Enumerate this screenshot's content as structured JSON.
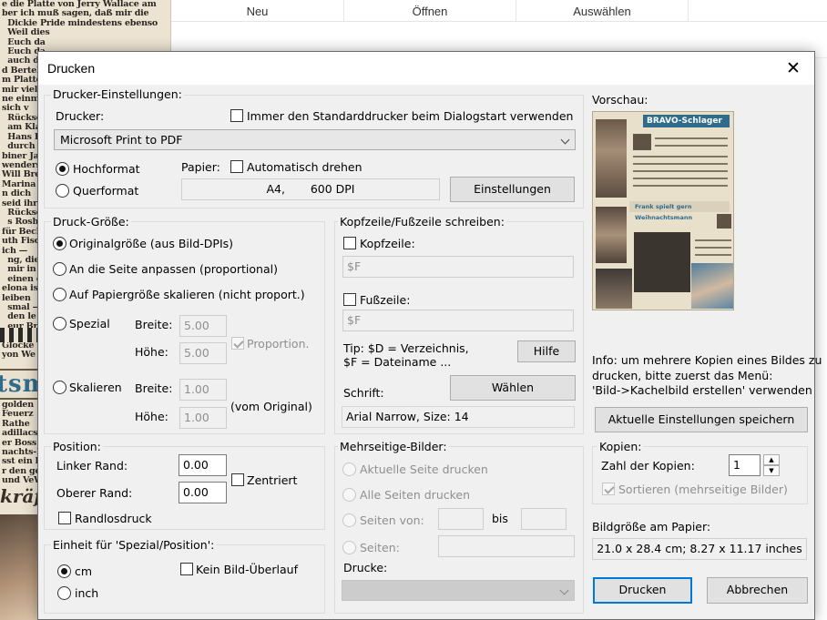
{
  "background": {
    "paper_text": "e die Platte von Jerry Wallace am\nber ich muß sagen, daß mir die\n  Dickie Pride mindestens ebenso\n  Weil dies\n  Euch da\n  Euch da\n  auch da\nd Bertelm\nm Platte W\nmir viel\nne einmal g\nsich v\n  Rückseit\n  am Klav\n  Hans Blum\n  durch\nbiner Jahre\nwenders ger\nWill Bren\nMarina — die\nn dich\nseid ihr\n  Rückseite\n  s Rosh\nfür Becher\nuth Fischer\nich —\n  ng, die al\n  mir in\n  einen d\nelona ist\nleiben\n  smal —\n  den le\n  eur Bra\nkönig\nGlocke\nyon We",
    "header_fragment": "tsm",
    "lower_text": "golden\nFeuerz\nRathe\nadillacs un\ner Boss\nnachts-Par\nsst ein hob\nr den ge\nund VeW",
    "italic_fragment": "kräft"
  },
  "app_header": {
    "columns": [
      "Neu",
      "Öffnen",
      "Auswählen"
    ]
  },
  "dialog": {
    "title": "Drucken",
    "close_glyph": "✕",
    "printer_settings": {
      "group_label": "Drucker-Einstellungen:",
      "printer_label": "Drucker:",
      "always_default_label": "Immer den Standarddrucker beim Dialogstart verwenden",
      "always_default_checked": false,
      "printer_value": "Microsoft Print to PDF",
      "portrait_label": "Hochformat",
      "landscape_label": "Querformat",
      "orientation_selected": "Hochformat",
      "paper_label": "Papier:",
      "auto_rotate_label": "Automatisch drehen",
      "auto_rotate_checked": false,
      "paper_format": "A4",
      "paper_dpi": "600 DPI",
      "settings_button": "Einstellungen"
    },
    "print_size": {
      "group_label": "Druck-Größe:",
      "options": [
        {
          "label": "Originalgröße (aus Bild-DPIs)",
          "selected": true
        },
        {
          "label": "An die Seite anpassen (proportional)",
          "selected": false
        },
        {
          "label": "Auf Papiergröße skalieren (nicht proport.)",
          "selected": false
        },
        {
          "label": "Spezial",
          "selected": false
        },
        {
          "label": "Skalieren",
          "selected": false
        }
      ],
      "width_label": "Breite:",
      "height_label": "Höhe:",
      "special_width": "5.00",
      "special_height": "5.00",
      "proportion_label": "Proportion.",
      "proportion_checked": true,
      "scale_width": "1.00",
      "scale_height": "1.00",
      "from_original_label": "(vom Original)"
    },
    "header_footer": {
      "group_label": "Kopfzeile/Fußzeile schreiben:",
      "header_label": "Kopfzeile:",
      "header_value": "$F",
      "footer_label": "Fußzeile:",
      "footer_value": "$F",
      "tip_line1": "Tip: $D = Verzeichnis,",
      "tip_line2": "$F = Dateiname ...",
      "help_button": "Hilfe",
      "font_label": "Schrift:",
      "choose_button": "Wählen",
      "font_value": "Arial Narrow, Size: 14"
    },
    "position": {
      "group_label": "Position:",
      "left_margin_label": "Linker Rand:",
      "left_margin_value": "0.00",
      "top_margin_label": "Oberer Rand:",
      "top_margin_value": "0.00",
      "centered_label": "Zentriert",
      "borderless_label": "Randlosdruck"
    },
    "unit": {
      "group_label": "Einheit für 'Spezial/Position':",
      "cm_label": "cm",
      "inch_label": "inch",
      "selected": "cm",
      "no_overflow_label": "Kein Bild-Überlauf"
    },
    "multipage": {
      "group_label": "Mehrseitige-Bilder:",
      "current_page_label": "Aktuelle Seite drucken",
      "all_pages_label": "Alle Seiten drucken",
      "pages_from_label": "Seiten von:",
      "to_label": "bis",
      "pages_label": "Seiten:",
      "prints_label": "Drucke:"
    },
    "preview": {
      "label": "Vorschau:",
      "banner_text": "BRAVO-Schlager",
      "subhead": "Frank spielt gern Weihnachtsmann",
      "info_text_line1": "Info: um mehrere Kopien eines Bildes zu",
      "info_text_line2": "drucken, bitte zuerst das Menü:",
      "info_text_line3": "'Bild->Kachelbild erstellen' verwenden",
      "save_settings_button": "Aktuelle Einstellungen speichern"
    },
    "copies": {
      "group_label": "Kopien:",
      "count_label": "Zahl der Kopien:",
      "count_value": "1",
      "sort_label": "Sortieren (mehrseitige Bilder)",
      "sort_checked": true
    },
    "image_size": {
      "label": "Bildgröße am Papier:",
      "value": "21.0 x 28.4 cm; 8.27 x 11.17 inches"
    },
    "print_button": "Drucken",
    "cancel_button": "Abbrechen"
  }
}
